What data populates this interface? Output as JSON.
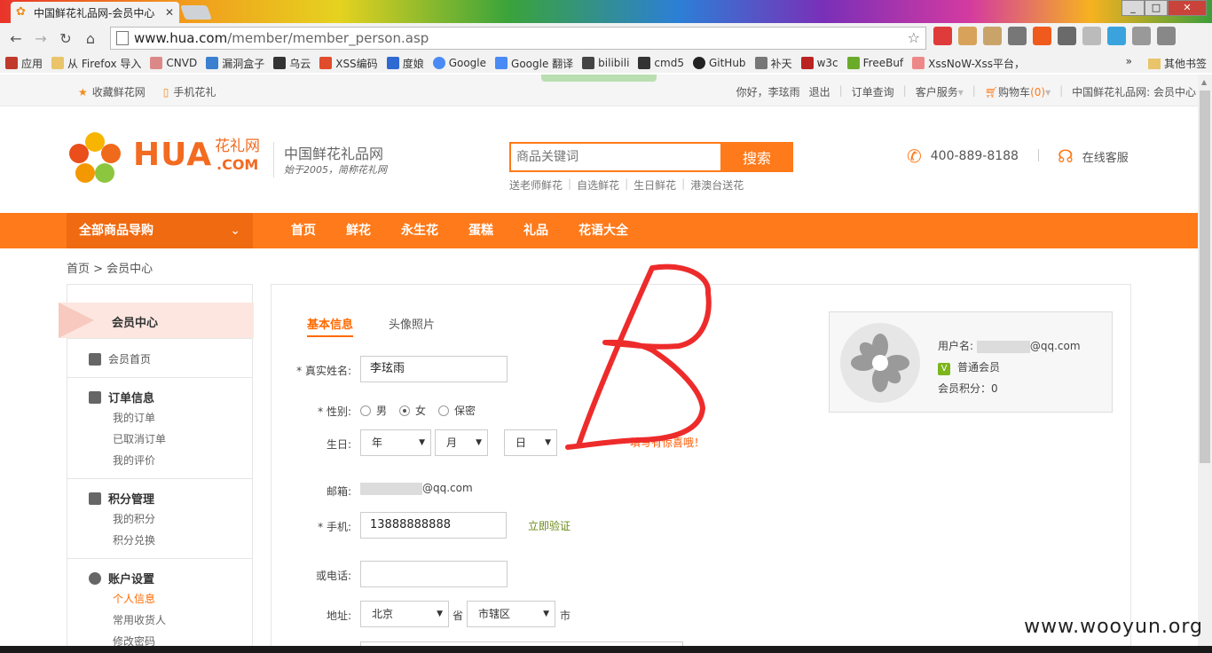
{
  "browser": {
    "tab_title": "中国鲜花礼品网-会员中心",
    "tab_close": "✕",
    "url_host": "www.hua.com",
    "url_path": "/member/member_person.asp",
    "window_buttons": [
      "_",
      "□",
      "✕"
    ]
  },
  "bookmarks": {
    "items": [
      {
        "label": "应用",
        "icon": "apps-icon"
      },
      {
        "label": "从 Firefox 导入",
        "icon": "folder-icon"
      },
      {
        "label": "CNVD",
        "icon": "cnvd-icon"
      },
      {
        "label": "漏洞盒子",
        "icon": "shield-icon"
      },
      {
        "label": "乌云",
        "icon": "wooyun-icon"
      },
      {
        "label": "XSS编码",
        "icon": "v-icon"
      },
      {
        "label": "度娘",
        "icon": "paw-icon"
      },
      {
        "label": "Google",
        "icon": "google-icon"
      },
      {
        "label": "Google 翻译",
        "icon": "translate-icon"
      },
      {
        "label": "bilibili",
        "icon": "tv-icon"
      },
      {
        "label": "cmd5",
        "icon": "grid-icon"
      },
      {
        "label": "GitHub",
        "icon": "github-icon"
      },
      {
        "label": "补天",
        "icon": "star-icon"
      },
      {
        "label": "w3c",
        "icon": "w3-icon"
      },
      {
        "label": "FreeBuf",
        "icon": "freebuf-icon"
      },
      {
        "label": "XssNoW-Xss平台，",
        "icon": "xss-icon"
      }
    ],
    "more": "»",
    "other": "其他书签"
  },
  "topbar": {
    "favorite": "收藏鲜花网",
    "mobile": "手机花礼",
    "greeting": "你好，李玹雨",
    "logout": "退出",
    "orders": "订单查询",
    "service": "客户服务",
    "cart": "购物车",
    "cart_count": "(0)",
    "site_name": "中国鲜花礼品网: 会员中心"
  },
  "header": {
    "logo_text": "HUA",
    "logo_cn": "花礼网",
    "logo_com": ".COM",
    "slogan_main": "中国鲜花礼品网",
    "slogan_sub": "始于2005，简称花礼网",
    "search_placeholder": "商品关键词",
    "search_button": "搜索",
    "hot_words": [
      "送老师鲜花",
      "自选鲜花",
      "生日鲜花",
      "港澳台送花"
    ],
    "phone": "400-889-8188",
    "online_service": "在线客服"
  },
  "nav": {
    "all_products": "全部商品导购",
    "items": [
      "首页",
      "鲜花",
      "永生花",
      "蛋糕",
      "礼品",
      "花语大全"
    ]
  },
  "breadcrumb": "首页 > 会员中心",
  "sidebar": {
    "title": "会员中心",
    "home": "会员首页",
    "orders_title": "订单信息",
    "orders_links": [
      "我的订单",
      "已取消订单",
      "我的评价"
    ],
    "points_title": "积分管理",
    "points_links": [
      "我的积分",
      "积分兑换"
    ],
    "account_title": "账户设置",
    "account_links": [
      "个人信息",
      "常用收货人",
      "修改密码"
    ]
  },
  "form": {
    "tab_basic": "基本信息",
    "tab_avatar": "头像照片",
    "name_label": "* 真实姓名:",
    "name_value": "李玹雨",
    "gender_label": "* 性别:",
    "gender_options": [
      "男",
      "女",
      "保密"
    ],
    "gender_selected": "女",
    "birthday_label": "生日:",
    "year": "年",
    "month": "月",
    "day": "日",
    "birthday_tip": "填写有惊喜哦！",
    "email_label": "邮箱:",
    "email_suffix": "@qq.com",
    "mobile_label": "* 手机:",
    "mobile_value": "13888888888",
    "verify": "立即验证",
    "tel_label": "或电话:",
    "address_label": "地址:",
    "province": "北京",
    "province_unit": "省",
    "city": "市辖区",
    "city_unit": "市"
  },
  "user_card": {
    "username_label": "用户名:",
    "username_suffix": "@qq.com",
    "level_badge": "V",
    "level": "普通会员",
    "points": "会员积分：0"
  },
  "watermark": "www.wooyun.org",
  "colors": {
    "accent": "#ff7a1a",
    "scribble": "#ee2b2b"
  }
}
